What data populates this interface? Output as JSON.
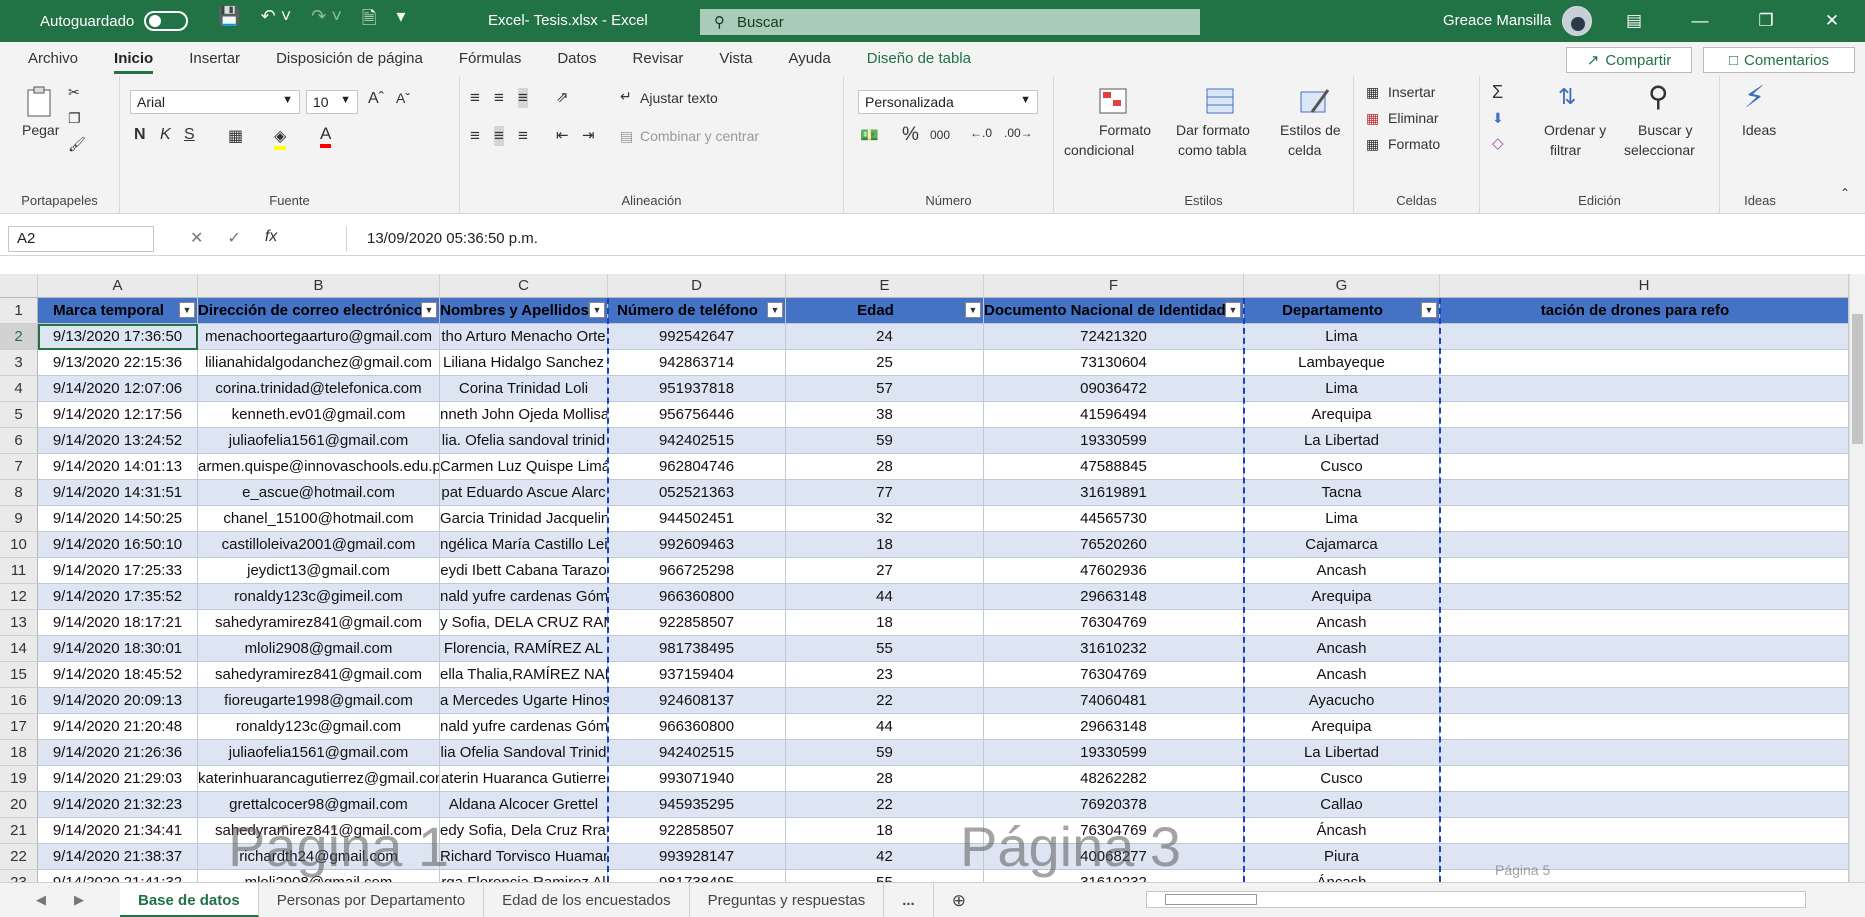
{
  "titlebar": {
    "autosave_label": "Autoguardado",
    "doc_title": "Excel- Tesis.xlsx - Excel",
    "search_placeholder": "Buscar",
    "user_name": "Greace Mansilla"
  },
  "ribbon_tabs": [
    "Archivo",
    "Inicio",
    "Insertar",
    "Disposición de página",
    "Fórmulas",
    "Datos",
    "Revisar",
    "Vista",
    "Ayuda",
    "Diseño de tabla"
  ],
  "share_label": "Compartir",
  "comments_label": "Comentarios",
  "ribbon": {
    "portapapeles": {
      "label": "Portapapeles",
      "paste": "Pegar"
    },
    "fuente": {
      "label": "Fuente",
      "font": "Arial",
      "size": "10",
      "bold": "N",
      "italic": "K",
      "underline": "S"
    },
    "alineacion": {
      "label": "Alineación",
      "wrap": "Ajustar texto",
      "merge": "Combinar y centrar"
    },
    "numero": {
      "label": "Número",
      "format": "Personalizada",
      "percent": "%",
      "thousands": "000"
    },
    "estilos": {
      "label": "Estilos",
      "cond": "Formato condicional",
      "cond1": "Formato",
      "cond2": "condicional",
      "table1": "Dar formato",
      "table2": "como tabla",
      "cell1": "Estilos de",
      "cell2": "celda"
    },
    "celdas": {
      "label": "Celdas",
      "insert": "Insertar",
      "delete": "Eliminar",
      "format": "Formato"
    },
    "edicion": {
      "label": "Edición",
      "sort1": "Ordenar y",
      "sort2": "filtrar",
      "find1": "Buscar y",
      "find2": "seleccionar"
    },
    "ideas": {
      "label": "Ideas",
      "btn": "Ideas"
    }
  },
  "formula_bar": {
    "name_box": "A2",
    "formula": "13/09/2020  05:36:50 p.m."
  },
  "columns": [
    "A",
    "B",
    "C",
    "D",
    "E",
    "F",
    "G",
    "H"
  ],
  "headers": [
    "Marca temporal",
    "Dirección de correo electrónico",
    "Nombres y Apellidos",
    "Número de teléfono",
    "Edad",
    "Documento Nacional de Identidad",
    "Departamento",
    "tación de drones para refo"
  ],
  "rows": [
    {
      "n": "2",
      "c": [
        "9/13/2020 17:36:50",
        "menachoortegaarturo@gmail.com",
        "tho Arturo Menacho Orte",
        "992542647",
        "24",
        "72421320",
        "Lima"
      ]
    },
    {
      "n": "3",
      "c": [
        "9/13/2020 22:15:36",
        "lilianahidalgodanchez@gmail.com",
        "Liliana Hidalgo Sanchez",
        "942863714",
        "25",
        "73130604",
        "Lambayeque"
      ]
    },
    {
      "n": "4",
      "c": [
        "9/14/2020 12:07:06",
        "corina.trinidad@telefonica.com",
        "Corina Trinidad Loli",
        "951937818",
        "57",
        "09036472",
        "Lima"
      ]
    },
    {
      "n": "5",
      "c": [
        "9/14/2020 12:17:56",
        "kenneth.ev01@gmail.com",
        "nneth John Ojeda Mollisa",
        "956756446",
        "38",
        "41596494",
        "Arequipa"
      ]
    },
    {
      "n": "6",
      "c": [
        "9/14/2020 13:24:52",
        "juliaofelia1561@gmail.com",
        "lia. Ofelia sandoval trinid",
        "942402515",
        "59",
        "19330599",
        "La Libertad"
      ]
    },
    {
      "n": "7",
      "c": [
        "9/14/2020 14:01:13",
        "armen.quispe@innovaschools.edu.p",
        "Carmen Luz Quispe Limá",
        "962804746",
        "28",
        "47588845",
        "Cusco"
      ]
    },
    {
      "n": "8",
      "c": [
        "9/14/2020 14:31:51",
        "e_ascue@hotmail.com",
        "pat Eduardo Ascue Alarc",
        "052521363",
        "77",
        "31619891",
        "Tacna"
      ]
    },
    {
      "n": "9",
      "c": [
        "9/14/2020 14:50:25",
        "chanel_15100@hotmail.com",
        "Garcia Trinidad Jacqueline",
        "944502451",
        "32",
        "44565730",
        "Lima"
      ]
    },
    {
      "n": "10",
      "c": [
        "9/14/2020 16:50:10",
        "castilloleiva2001@gmail.com",
        "ngélica María Castillo Lei",
        "992609463",
        "18",
        "76520260",
        "Cajamarca"
      ]
    },
    {
      "n": "11",
      "c": [
        "9/14/2020 17:25:33",
        "jeydict13@gmail.com",
        "eydi Ibett Cabana Tarazo",
        "966725298",
        "27",
        "47602936",
        "Ancash"
      ]
    },
    {
      "n": "12",
      "c": [
        "9/14/2020 17:35:52",
        "ronaldy123c@gimeil.com",
        "nald yufre cardenas Góm",
        "966360800",
        "44",
        "29663148",
        "Arequipa"
      ]
    },
    {
      "n": "13",
      "c": [
        "9/14/2020 18:17:21",
        "sahedyramirez841@gmail.com",
        "y Sofia, DELA CRUZ RAM",
        "922858507",
        "18",
        "76304769",
        "Ancash"
      ]
    },
    {
      "n": "14",
      "c": [
        "9/14/2020 18:30:01",
        "mloli2908@gmail.com",
        "Florencia, RAMÍREZ AL",
        "981738495",
        "55",
        "31610232",
        "Ancash"
      ]
    },
    {
      "n": "15",
      "c": [
        "9/14/2020 18:45:52",
        "sahedyramirez841@gmail.com",
        "ella Thalia,RAMÍREZ NAR",
        "937159404",
        "23",
        "76304769",
        "Ancash"
      ]
    },
    {
      "n": "16",
      "c": [
        "9/14/2020 20:09:13",
        "fioreugarte1998@gmail.com",
        "a Mercedes Ugarte Hinos",
        "924608137",
        "22",
        "74060481",
        "Ayacucho"
      ]
    },
    {
      "n": "17",
      "c": [
        "9/14/2020 21:20:48",
        "ronaldy123c@gmail.com",
        "nald yufre cardenas Góm",
        "966360800",
        "44",
        "29663148",
        "Arequipa"
      ]
    },
    {
      "n": "18",
      "c": [
        "9/14/2020 21:26:36",
        "juliaofelia1561@gmail.com",
        "lia Ofelia Sandoval Trinid",
        "942402515",
        "59",
        "19330599",
        "La Libertad"
      ]
    },
    {
      "n": "19",
      "c": [
        "9/14/2020 21:29:03",
        "katerinhuarancagutierrez@gmail.com",
        "aterin Huaranca Gutierre",
        "993071940",
        "28",
        "48262282",
        "Cusco"
      ]
    },
    {
      "n": "20",
      "c": [
        "9/14/2020 21:32:23",
        "grettalcocer98@gmail.com",
        "Aldana Alcocer Grettel",
        "945935295",
        "22",
        "76920378",
        "Callao"
      ]
    },
    {
      "n": "21",
      "c": [
        "9/14/2020 21:34:41",
        "sahedyramirez841@gmail.com",
        "edy Sofia, Dela Cruz Rrar",
        "922858507",
        "18",
        "76304769",
        "Áncash"
      ]
    },
    {
      "n": "22",
      "c": [
        "9/14/2020 21:38:37",
        "richardth24@gmail.com",
        "Richard Torvisco Huaman",
        "993928147",
        "42",
        "40068277",
        "Piura"
      ]
    },
    {
      "n": "23",
      "c": [
        "9/14/2020 21:41:32",
        "mloli2908@gmail.com",
        "rga Florencia Ramirez Al",
        "981738495",
        "55",
        "31610232",
        "Áncash"
      ]
    }
  ],
  "watermarks": [
    "Página 1",
    "Página 3",
    "Página 5"
  ],
  "sheet_tabs": [
    "Base de datos",
    "Personas por Departamento",
    "Edad de los encuestados",
    "Preguntas y respuestas"
  ],
  "sheet_more": "...",
  "colors": {
    "excel_green": "#217346",
    "header_blue": "#4472c4",
    "band_blue": "#dde5f3"
  }
}
